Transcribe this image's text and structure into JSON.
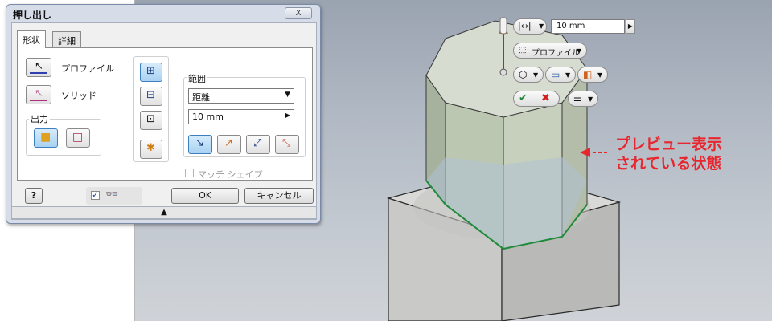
{
  "dialog": {
    "title": "押し出し",
    "close_label": "X",
    "tabs": [
      "形状",
      "詳細"
    ],
    "profile_label": "プロファイル",
    "solid_label": "ソリッド",
    "output_label": "出力",
    "extents_label": "範囲",
    "extents_value": "距離",
    "distance_value": "10 mm",
    "match_shape_label": "マッチ シェイプ",
    "ok_label": "OK",
    "cancel_label": "キャンセル",
    "help_label": "?",
    "preview_checked": true
  },
  "minitoolbar": {
    "distance_value": "10 mm",
    "profile_label": "プロファイル"
  },
  "callout": {
    "line1": "プレビュー表示",
    "line2": "されている状態"
  },
  "colors": {
    "accent_red": "#e8262d",
    "selected_blue": "#3d7fbf",
    "preview_edge_green": "#1e8a3a"
  }
}
